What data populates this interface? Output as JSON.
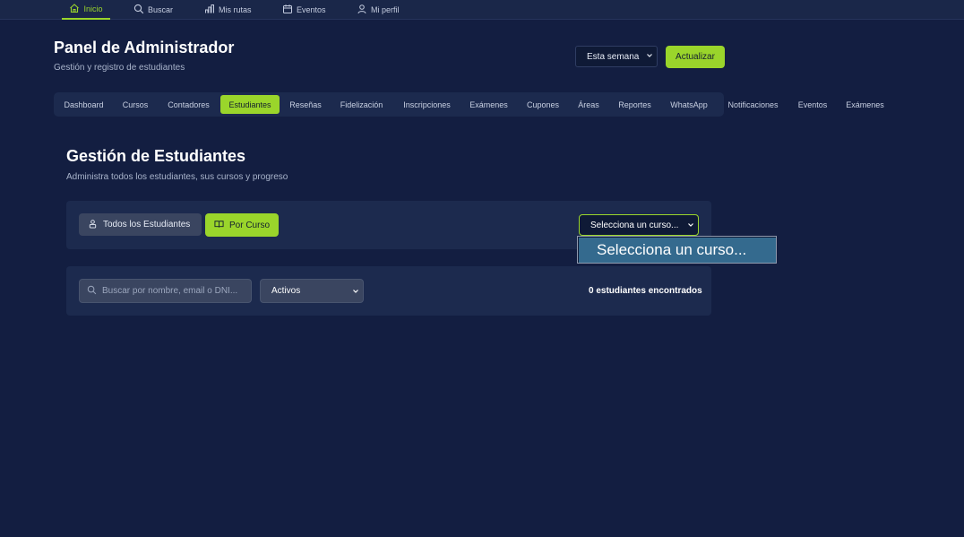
{
  "topnav": {
    "items": [
      {
        "label": "Inicio",
        "icon": "home-icon"
      },
      {
        "label": "Buscar",
        "icon": "search-icon"
      },
      {
        "label": "Mis rutas",
        "icon": "chart-icon"
      },
      {
        "label": "Eventos",
        "icon": "calendar-icon"
      },
      {
        "label": "Mi perfil",
        "icon": "user-icon"
      }
    ],
    "active": "Inicio"
  },
  "header": {
    "title": "Panel de Administrador",
    "subtitle": "Gestión y registro de estudiantes",
    "period_select": "Esta semana",
    "refresh_label": "Actualizar"
  },
  "tabs": {
    "items": [
      "Dashboard",
      "Cursos",
      "Contadores",
      "Estudiantes",
      "Reseñas",
      "Fidelización",
      "Inscripciones",
      "Exámenes",
      "Cupones",
      "Áreas",
      "Reportes",
      "WhatsApp",
      "Notificaciones",
      "Eventos",
      "Exámenes"
    ],
    "active": "Estudiantes"
  },
  "section": {
    "title": "Gestión de Estudiantes",
    "subtitle": "Administra todos los estudiantes, sus cursos y progreso"
  },
  "view_toggle": {
    "all_label": "Todos los Estudiantes",
    "course_label": "Por Curso"
  },
  "course_select": {
    "value": "Selecciona un curso...",
    "options": [
      "Selecciona un curso..."
    ]
  },
  "filters": {
    "search_placeholder": "Buscar por nombre, email o DNI...",
    "status_select": "Activos",
    "result_count": "0 estudiantes encontrados"
  },
  "colors": {
    "background": "#131e41",
    "panel": "#1c2a4e",
    "accent": "#9ad52b",
    "option_highlight": "#346a8e"
  }
}
